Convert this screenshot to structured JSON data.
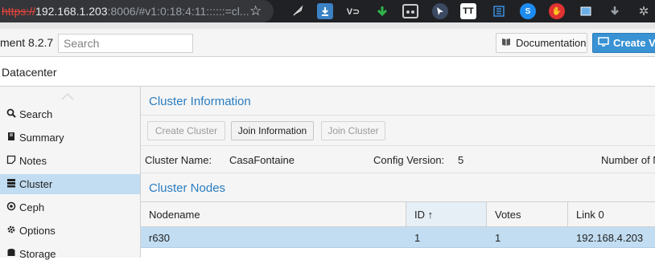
{
  "browser": {
    "url_scheme": "https://",
    "url_host": "192.168.1.203",
    "url_rest": ":8006/#v1:0:18:4:11::::::=cl...",
    "extensions": [
      "feather-icon",
      "download-icon",
      "vd-icon",
      "arrow-down-icon",
      "meter-icon",
      "cursor-icon",
      "tt-icon",
      "list-icon",
      "shazam-icon",
      "hand-icon",
      "picture-icon",
      "download-gray-icon",
      "gear-icon"
    ]
  },
  "toolbar": {
    "version_text": "ment 8.2.7",
    "search_placeholder": "Search",
    "documentation_label": "Documentation",
    "create_vm_label": "Create VM"
  },
  "breadcrumb": {
    "label": "Datacenter"
  },
  "sidebar": {
    "items": [
      {
        "label": "Search",
        "icon": "search-icon"
      },
      {
        "label": "Summary",
        "icon": "book-icon"
      },
      {
        "label": "Notes",
        "icon": "notes-icon"
      },
      {
        "label": "Cluster",
        "icon": "server-icon"
      },
      {
        "label": "Ceph",
        "icon": "ceph-icon"
      },
      {
        "label": "Options",
        "icon": "gear-icon"
      },
      {
        "label": "Storage",
        "icon": "database-icon"
      }
    ],
    "active": "Cluster"
  },
  "cluster_info": {
    "title": "Cluster Information",
    "buttons": {
      "create_cluster": "Create Cluster",
      "join_information": "Join Information",
      "join_cluster": "Join Cluster"
    },
    "name_label": "Cluster Name:",
    "name_value": "CasaFontaine",
    "config_label": "Config Version:",
    "config_value": "5",
    "nodes_label": "Number of N"
  },
  "cluster_nodes": {
    "title": "Cluster Nodes",
    "columns": [
      "Nodename",
      "ID ↑",
      "Votes",
      "Link 0"
    ],
    "rows": [
      {
        "nodename": "r630",
        "id": "1",
        "votes": "1",
        "link0": "192.168.4.203"
      }
    ]
  },
  "colors": {
    "accent": "#3892d4",
    "selected": "#c2ddf2",
    "title": "#2a7dc0"
  }
}
